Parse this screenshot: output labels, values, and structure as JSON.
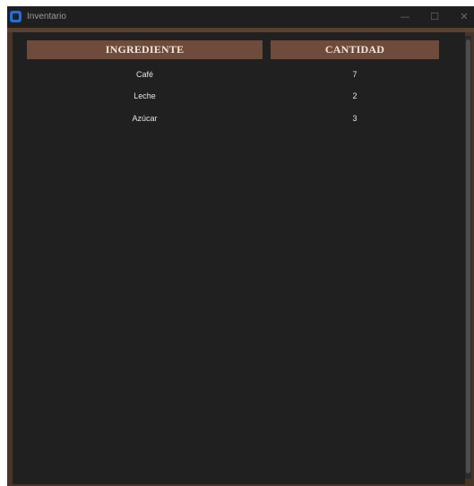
{
  "window": {
    "title": "Inventario",
    "controls": {
      "minimize": "—",
      "maximize": "☐",
      "close": "✕"
    }
  },
  "table": {
    "headers": {
      "ingrediente": "INGREDIENTE",
      "cantidad": "CANTIDAD"
    },
    "rows": [
      {
        "ingrediente": "Café",
        "cantidad": "7"
      },
      {
        "ingrediente": "Leche",
        "cantidad": "2"
      },
      {
        "ingrediente": "Azúcar",
        "cantidad": "3"
      }
    ]
  },
  "colors": {
    "header_bg": "#6e4b3a",
    "frame": "#4a3427",
    "background": "#202020",
    "app_icon": "#1e6fe0"
  }
}
